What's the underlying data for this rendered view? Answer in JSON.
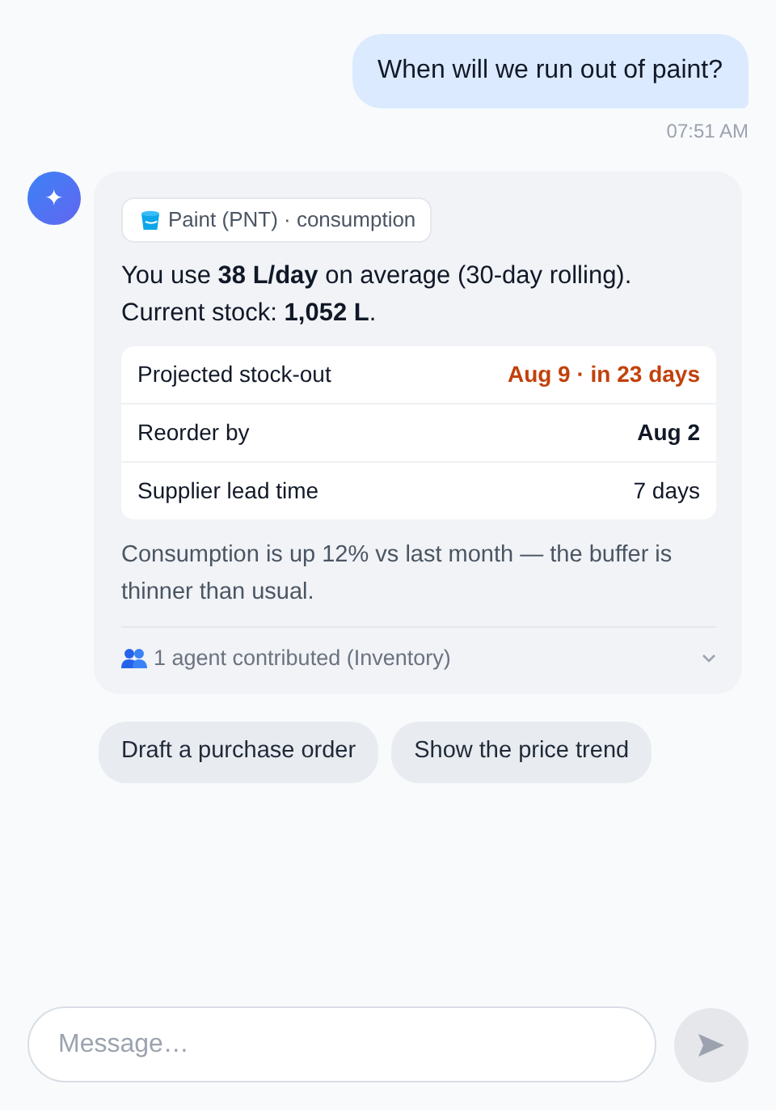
{
  "user_message": {
    "text": "When will we run out of paint?",
    "time": "07:51 AM"
  },
  "assistant": {
    "avatar_glyph": "✦",
    "context_tag": "Paint (PNT) · consumption",
    "summary": "You use **38 L/day** on average (30-day rolling). Current stock: **1,052 L**.",
    "facts": [
      {
        "label": "Projected stock-out",
        "value": "Aug 9 · in 23 days",
        "kind": "alert"
      },
      {
        "label": "Reorder by",
        "value": "Aug 2",
        "kind": "strong"
      },
      {
        "label": "Supplier lead time",
        "value": "7 days",
        "kind": "plain"
      }
    ],
    "note": "Consumption is up 12% vs last month — the buffer is thinner than usual.",
    "contributors": {
      "text": "1 agent contributed (Inventory)",
      "expanded": false
    }
  },
  "suggestions": [
    "Draft a purchase order",
    "Show the price trend"
  ],
  "composer": {
    "placeholder": "Message…"
  }
}
